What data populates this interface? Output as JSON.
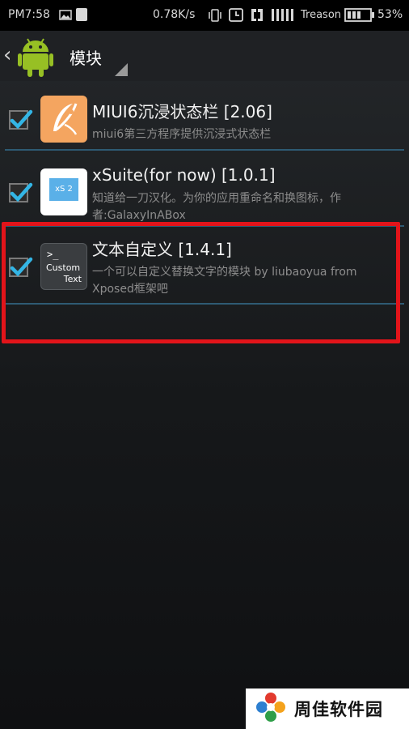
{
  "status_bar": {
    "time": "PM7:58",
    "speed": "0.78K/s",
    "carrier": "Treason",
    "battery": "53%"
  },
  "action_bar": {
    "title": "模块"
  },
  "modules": [
    {
      "title": "MIUI6沉浸状态栏 [2.06]",
      "description": "miui6第三方程序提供沉浸式状态栏",
      "checked": true,
      "icon": "feather-app-icon"
    },
    {
      "title": "xSuite(for now) [1.0.1]",
      "description": "知道给一刀汉化。为你的应用重命名和换图标，作者:GalaxyInABox",
      "icon_text": "xS 2",
      "checked": true,
      "icon": "xsuite-app-icon"
    },
    {
      "title": "文本自定义 [1.4.1]",
      "description": "一个可以自定义替换文字的模块 by liubaoyua from Xposed框架吧",
      "icon_lines": [
        ">_",
        "Custom",
        "Text"
      ],
      "checked": true,
      "icon": "custom-text-app-icon"
    }
  ],
  "watermark": {
    "text": "周佳软件园"
  },
  "colors": {
    "highlight": "#e2141a",
    "checkmark": "#33b5e5",
    "divider": "#2e5a73"
  }
}
